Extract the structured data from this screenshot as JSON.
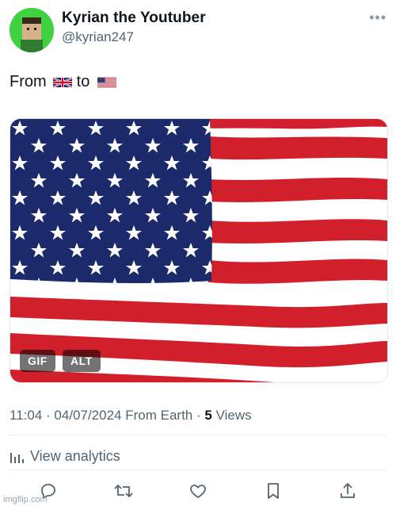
{
  "author": {
    "display_name": "Kyrian the Youtuber",
    "handle": "@kyrian247",
    "avatar_color": "#3fd13f"
  },
  "more_glyph": "•••",
  "tweet": {
    "text_before": "From",
    "text_middle": "to",
    "flag_from": "uk-flag",
    "flag_to": "us-flag"
  },
  "media": {
    "type": "us-flag-gif",
    "badge_gif": "GIF",
    "badge_alt": "ALT"
  },
  "meta": {
    "time": "11:04",
    "date": "04/07/2024",
    "source": "From Earth",
    "views_count": "5",
    "views_label": "Views",
    "separator": "·"
  },
  "analytics": {
    "label": "View analytics"
  },
  "actions": [
    "reply-icon",
    "retweet-icon",
    "like-icon",
    "bookmark-icon",
    "share-icon"
  ],
  "watermark": "imgflip.com",
  "colors": {
    "text": "#0f1419",
    "secondary": "#536471",
    "flag_red": "#c8102e",
    "flag_blue": "#1c2a6b"
  }
}
